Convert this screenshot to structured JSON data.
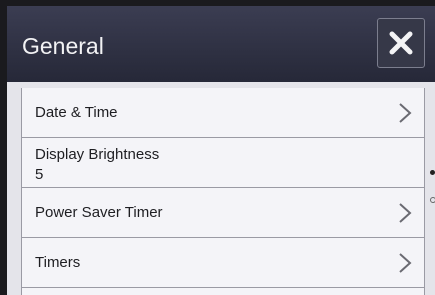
{
  "header": {
    "title": "General",
    "close_icon": "close-icon"
  },
  "items": [
    {
      "label": "Date & Time",
      "icon": "chevron-right-icon"
    },
    {
      "label": "Display Brightness",
      "value": "5"
    },
    {
      "label": "Power Saver Timer",
      "icon": "chevron-right-icon"
    },
    {
      "label": "Timers",
      "icon": "chevron-right-icon"
    }
  ],
  "colors": {
    "header": "#2e3042",
    "list": "#f4f4f8",
    "text": "#1e1e22"
  }
}
